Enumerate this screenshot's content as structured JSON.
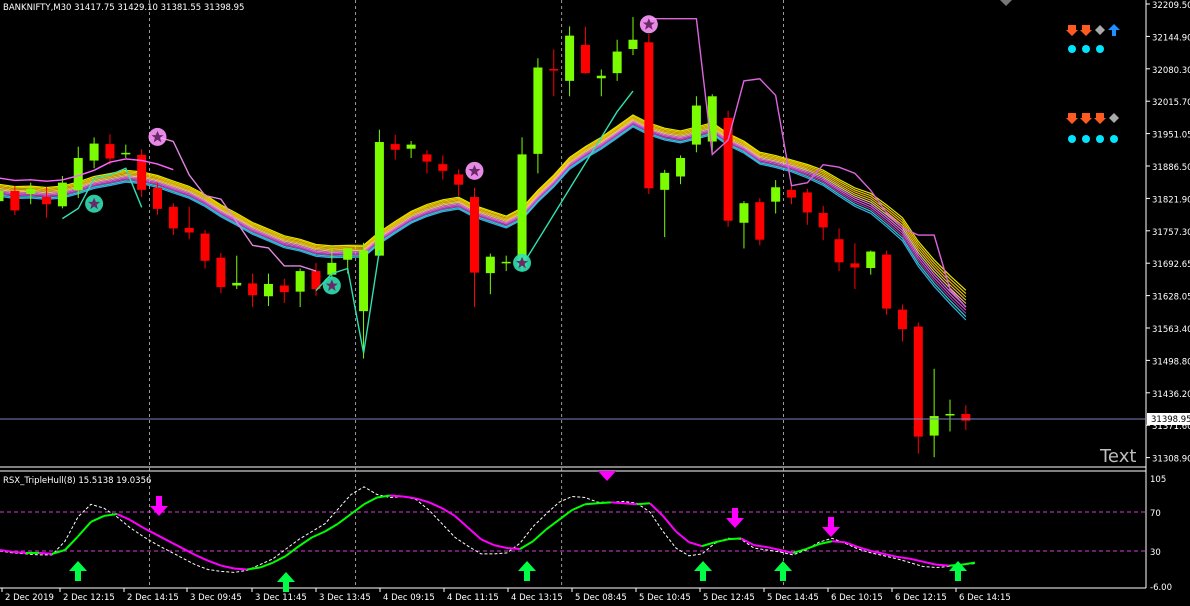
{
  "header": {
    "symbol_info": "BANKNIFTY,M30  31417.75 31429.10 31381.55 31398.95"
  },
  "indicator": {
    "title": "RSX_TripleHull(8) 15.5138 19.0356"
  },
  "corner_text": "Text",
  "price_axis": {
    "ticks": [
      "32209.50",
      "32144.90",
      "32080.30",
      "32015.70",
      "31951.05",
      "31886.50",
      "31821.90",
      "31757.30",
      "31692.65",
      "31628.05",
      "31563.40",
      "31498.80",
      "31436.20",
      "31371.60",
      "31308.90"
    ],
    "current_price": "31398.95"
  },
  "sub_axis": {
    "ticks": [
      "105",
      "70",
      "30",
      "-6.00"
    ]
  },
  "time_axis": {
    "labels": [
      "2 Dec 2019",
      "2 Dec 12:15",
      "2 Dec 14:15",
      "3 Dec 09:45",
      "3 Dec 11:45",
      "3 Dec 13:45",
      "4 Dec 09:15",
      "4 Dec 11:15",
      "4 Dec 13:15",
      "5 Dec 08:45",
      "5 Dec 10:45",
      "5 Dec 12:45",
      "5 Dec 14:45",
      "6 Dec 10:15",
      "6 Dec 12:15",
      "6 Dec 14:15"
    ]
  },
  "colors": {
    "bull": "#7cfc00",
    "bear": "#ff0000",
    "grid": "#c0c0c0",
    "rsx_up": "#00ff00",
    "rsx_down": "#ff00ff"
  },
  "signals": {
    "row1": [
      "arrow-down-orange",
      "arrow-down-orange",
      "diamond-gray",
      "arrow-up-blue"
    ],
    "row2": [
      "arrow-down-orange",
      "arrow-down-orange",
      "arrow-down-orange",
      "diamond-gray"
    ]
  },
  "chart_data": {
    "type": "candlestick",
    "title": "BANKNIFTY,M30",
    "ylim": [
      31300,
      32215
    ],
    "candles": [
      {
        "x": "2 Dec 10:15",
        "o": 31826,
        "h": 31851,
        "l": 31793,
        "c": 31846
      },
      {
        "x": "2 Dec 10:45",
        "o": 31846,
        "h": 31856,
        "l": 31799,
        "c": 31808
      },
      {
        "x": "2 Dec 11:15",
        "o": 31840,
        "h": 31862,
        "l": 31820,
        "c": 31850
      },
      {
        "x": "2 Dec 11:45",
        "o": 31834,
        "h": 31854,
        "l": 31794,
        "c": 31820
      },
      {
        "x": "2 Dec 12:15",
        "o": 31816,
        "h": 31875,
        "l": 31812,
        "c": 31862
      },
      {
        "x": "2 Dec 12:45",
        "o": 31847,
        "h": 31932,
        "l": 31832,
        "c": 31910
      },
      {
        "x": "2 Dec 13:15",
        "o": 31905,
        "h": 31950,
        "l": 31890,
        "c": 31938
      },
      {
        "x": "2 Dec 13:45",
        "o": 31937,
        "h": 31956,
        "l": 31897,
        "c": 31909
      },
      {
        "x": "2 Dec 14:15",
        "o": 31917,
        "h": 31936,
        "l": 31910,
        "c": 31920
      },
      {
        "x": "2 Dec 14:45",
        "o": 31916,
        "h": 31927,
        "l": 31834,
        "c": 31848
      },
      {
        "x": "2 Dec 15:15",
        "o": 31852,
        "h": 31862,
        "l": 31800,
        "c": 31811
      },
      {
        "x": "3 Dec 09:15",
        "o": 31815,
        "h": 31822,
        "l": 31760,
        "c": 31773
      },
      {
        "x": "3 Dec 09:45",
        "o": 31774,
        "h": 31815,
        "l": 31752,
        "c": 31765
      },
      {
        "x": "3 Dec 10:15",
        "o": 31763,
        "h": 31770,
        "l": 31695,
        "c": 31710
      },
      {
        "x": "3 Dec 10:45",
        "o": 31716,
        "h": 31725,
        "l": 31647,
        "c": 31659
      },
      {
        "x": "3 Dec 11:15",
        "o": 31662,
        "h": 31720,
        "l": 31655,
        "c": 31667
      },
      {
        "x": "3 Dec 11:45",
        "o": 31666,
        "h": 31685,
        "l": 31620,
        "c": 31643
      },
      {
        "x": "3 Dec 12:15",
        "o": 31641,
        "h": 31685,
        "l": 31622,
        "c": 31665
      },
      {
        "x": "3 Dec 12:45",
        "o": 31662,
        "h": 31675,
        "l": 31628,
        "c": 31649
      },
      {
        "x": "3 Dec 13:15",
        "o": 31650,
        "h": 31695,
        "l": 31620,
        "c": 31690
      },
      {
        "x": "3 Dec 13:45",
        "o": 31690,
        "h": 31706,
        "l": 31642,
        "c": 31655
      },
      {
        "x": "3 Dec 14:15",
        "o": 31683,
        "h": 31735,
        "l": 31675,
        "c": 31706
      },
      {
        "x": "3 Dec 14:45",
        "o": 31712,
        "h": 31733,
        "l": 31685,
        "c": 31734
      },
      {
        "x": "4 Dec 09:15",
        "o": 31612,
        "h": 31745,
        "l": 31520,
        "c": 31730
      },
      {
        "x": "4 Dec 09:45",
        "o": 31720,
        "h": 31965,
        "l": 31720,
        "c": 31941
      },
      {
        "x": "4 Dec 10:15",
        "o": 31937,
        "h": 31955,
        "l": 31907,
        "c": 31926
      },
      {
        "x": "4 Dec 10:45",
        "o": 31928,
        "h": 31943,
        "l": 31910,
        "c": 31936
      },
      {
        "x": "4 Dec 11:15",
        "o": 31917,
        "h": 31925,
        "l": 31880,
        "c": 31903
      },
      {
        "x": "4 Dec 11:45",
        "o": 31898,
        "h": 31915,
        "l": 31868,
        "c": 31885
      },
      {
        "x": "4 Dec 12:15",
        "o": 31878,
        "h": 31888,
        "l": 31836,
        "c": 31858
      },
      {
        "x": "4 Dec 12:45",
        "o": 31834,
        "h": 31852,
        "l": 31620,
        "c": 31687
      },
      {
        "x": "4 Dec 13:15",
        "o": 31686,
        "h": 31724,
        "l": 31645,
        "c": 31718
      },
      {
        "x": "4 Dec 13:45",
        "o": 31705,
        "h": 31720,
        "l": 31690,
        "c": 31708
      },
      {
        "x": "4 Dec 14:15",
        "o": 31698,
        "h": 31950,
        "l": 31690,
        "c": 31917
      },
      {
        "x": "4 Dec 14:45",
        "o": 31918,
        "h": 32104,
        "l": 31880,
        "c": 32086
      },
      {
        "x": "5 Dec 08:45",
        "o": 32083,
        "h": 32121,
        "l": 32030,
        "c": 32082
      },
      {
        "x": "5 Dec 09:15",
        "o": 32060,
        "h": 32166,
        "l": 32030,
        "c": 32148
      },
      {
        "x": "5 Dec 09:45",
        "o": 32130,
        "h": 32165,
        "l": 32074,
        "c": 32075
      },
      {
        "x": "5 Dec 10:15",
        "o": 32065,
        "h": 32082,
        "l": 32030,
        "c": 32070
      },
      {
        "x": "5 Dec 10:45",
        "o": 32075,
        "h": 32140,
        "l": 32060,
        "c": 32117
      },
      {
        "x": "5 Dec 11:15",
        "o": 32122,
        "h": 32184,
        "l": 32110,
        "c": 32140
      },
      {
        "x": "5 Dec 11:45",
        "o": 32135,
        "h": 32151,
        "l": 31840,
        "c": 31851
      },
      {
        "x": "5 Dec 12:15",
        "o": 31848,
        "h": 31887,
        "l": 31756,
        "c": 31881
      },
      {
        "x": "5 Dec 12:45",
        "o": 31874,
        "h": 31915,
        "l": 31859,
        "c": 31910
      },
      {
        "x": "5 Dec 13:15",
        "o": 31936,
        "h": 32030,
        "l": 31921,
        "c": 32012
      },
      {
        "x": "5 Dec 13:45",
        "o": 31942,
        "h": 32034,
        "l": 31922,
        "c": 32030
      },
      {
        "x": "5 Dec 14:15",
        "o": 31988,
        "h": 32002,
        "l": 31776,
        "c": 31788
      },
      {
        "x": "5 Dec 14:45",
        "o": 31784,
        "h": 31826,
        "l": 31734,
        "c": 31822
      },
      {
        "x": "5 Dec 15:15",
        "o": 31824,
        "h": 31832,
        "l": 31740,
        "c": 31751
      },
      {
        "x": "6 Dec 09:15",
        "o": 31825,
        "h": 31867,
        "l": 31802,
        "c": 31853
      },
      {
        "x": "6 Dec 09:45",
        "o": 31848,
        "h": 31862,
        "l": 31820,
        "c": 31833
      },
      {
        "x": "6 Dec 10:15",
        "o": 31843,
        "h": 31850,
        "l": 31780,
        "c": 31804
      },
      {
        "x": "6 Dec 10:45",
        "o": 31803,
        "h": 31817,
        "l": 31750,
        "c": 31775
      },
      {
        "x": "6 Dec 11:15",
        "o": 31752,
        "h": 31773,
        "l": 31690,
        "c": 31707
      },
      {
        "x": "6 Dec 11:45",
        "o": 31705,
        "h": 31744,
        "l": 31655,
        "c": 31697
      },
      {
        "x": "6 Dec 12:15",
        "o": 31696,
        "h": 31730,
        "l": 31683,
        "c": 31728
      },
      {
        "x": "6 Dec 12:45",
        "o": 31722,
        "h": 31730,
        "l": 31605,
        "c": 31617
      },
      {
        "x": "6 Dec 13:15",
        "o": 31615,
        "h": 31625,
        "l": 31553,
        "c": 31577
      },
      {
        "x": "6 Dec 13:45",
        "o": 31582,
        "h": 31590,
        "l": 31335,
        "c": 31368
      },
      {
        "x": "6 Dec 14:15",
        "o": 31370,
        "h": 31500,
        "l": 31328,
        "c": 31408
      },
      {
        "x": "6 Dec 14:45",
        "o": 31410,
        "h": 31440,
        "l": 31378,
        "c": 31412
      },
      {
        "x": "6 Dec 15:15",
        "o": 31412,
        "h": 31429,
        "l": 31381,
        "c": 31399
      }
    ],
    "rsx": {
      "ylim": [
        -6,
        105
      ],
      "levels": [
        70,
        30
      ],
      "values": [
        31,
        29,
        28,
        28,
        27,
        31,
        45,
        60,
        66,
        68,
        62,
        54,
        47,
        40,
        33,
        26,
        20,
        15,
        12,
        11,
        13,
        18,
        25,
        35,
        44,
        50,
        58,
        68,
        78,
        85,
        87,
        86,
        84,
        80,
        74,
        66,
        54,
        42,
        36,
        33,
        32,
        40,
        52,
        62,
        72,
        78,
        79,
        80,
        79,
        78,
        79,
        66,
        50,
        39,
        35,
        39,
        42,
        43,
        36,
        34,
        31,
        28,
        32,
        37,
        40,
        39,
        34,
        30,
        27,
        24,
        22,
        19,
        16,
        15,
        16,
        18
      ]
    },
    "rsx_signal": {
      "values": [
        30,
        28,
        27,
        26,
        26,
        40,
        65,
        78,
        74,
        65,
        54,
        45,
        37,
        30,
        23,
        16,
        11,
        9,
        8,
        10,
        16,
        22,
        32,
        42,
        50,
        58,
        73,
        88,
        96,
        88,
        85,
        86,
        83,
        72,
        58,
        44,
        35,
        27,
        27,
        28,
        38,
        55,
        68,
        80,
        86,
        85,
        80,
        80,
        81,
        79,
        70,
        50,
        33,
        25,
        27,
        38,
        43,
        42,
        33,
        31,
        29,
        26,
        31,
        39,
        43,
        38,
        32,
        28,
        25,
        22,
        18,
        14,
        13,
        14,
        16,
        17
      ]
    },
    "buy_arrows_x": [
      "2 Dec 12:15",
      "4 Dec 13:15",
      "5 Dec 12:15",
      "5 Dec 14:15",
      "6 Dec 13:45"
    ],
    "sell_arrows_x": [
      "2 Dec 14:15",
      "5 Dec 08:45",
      "5 Dec 13:15",
      "5 Dec 15:15"
    ]
  }
}
